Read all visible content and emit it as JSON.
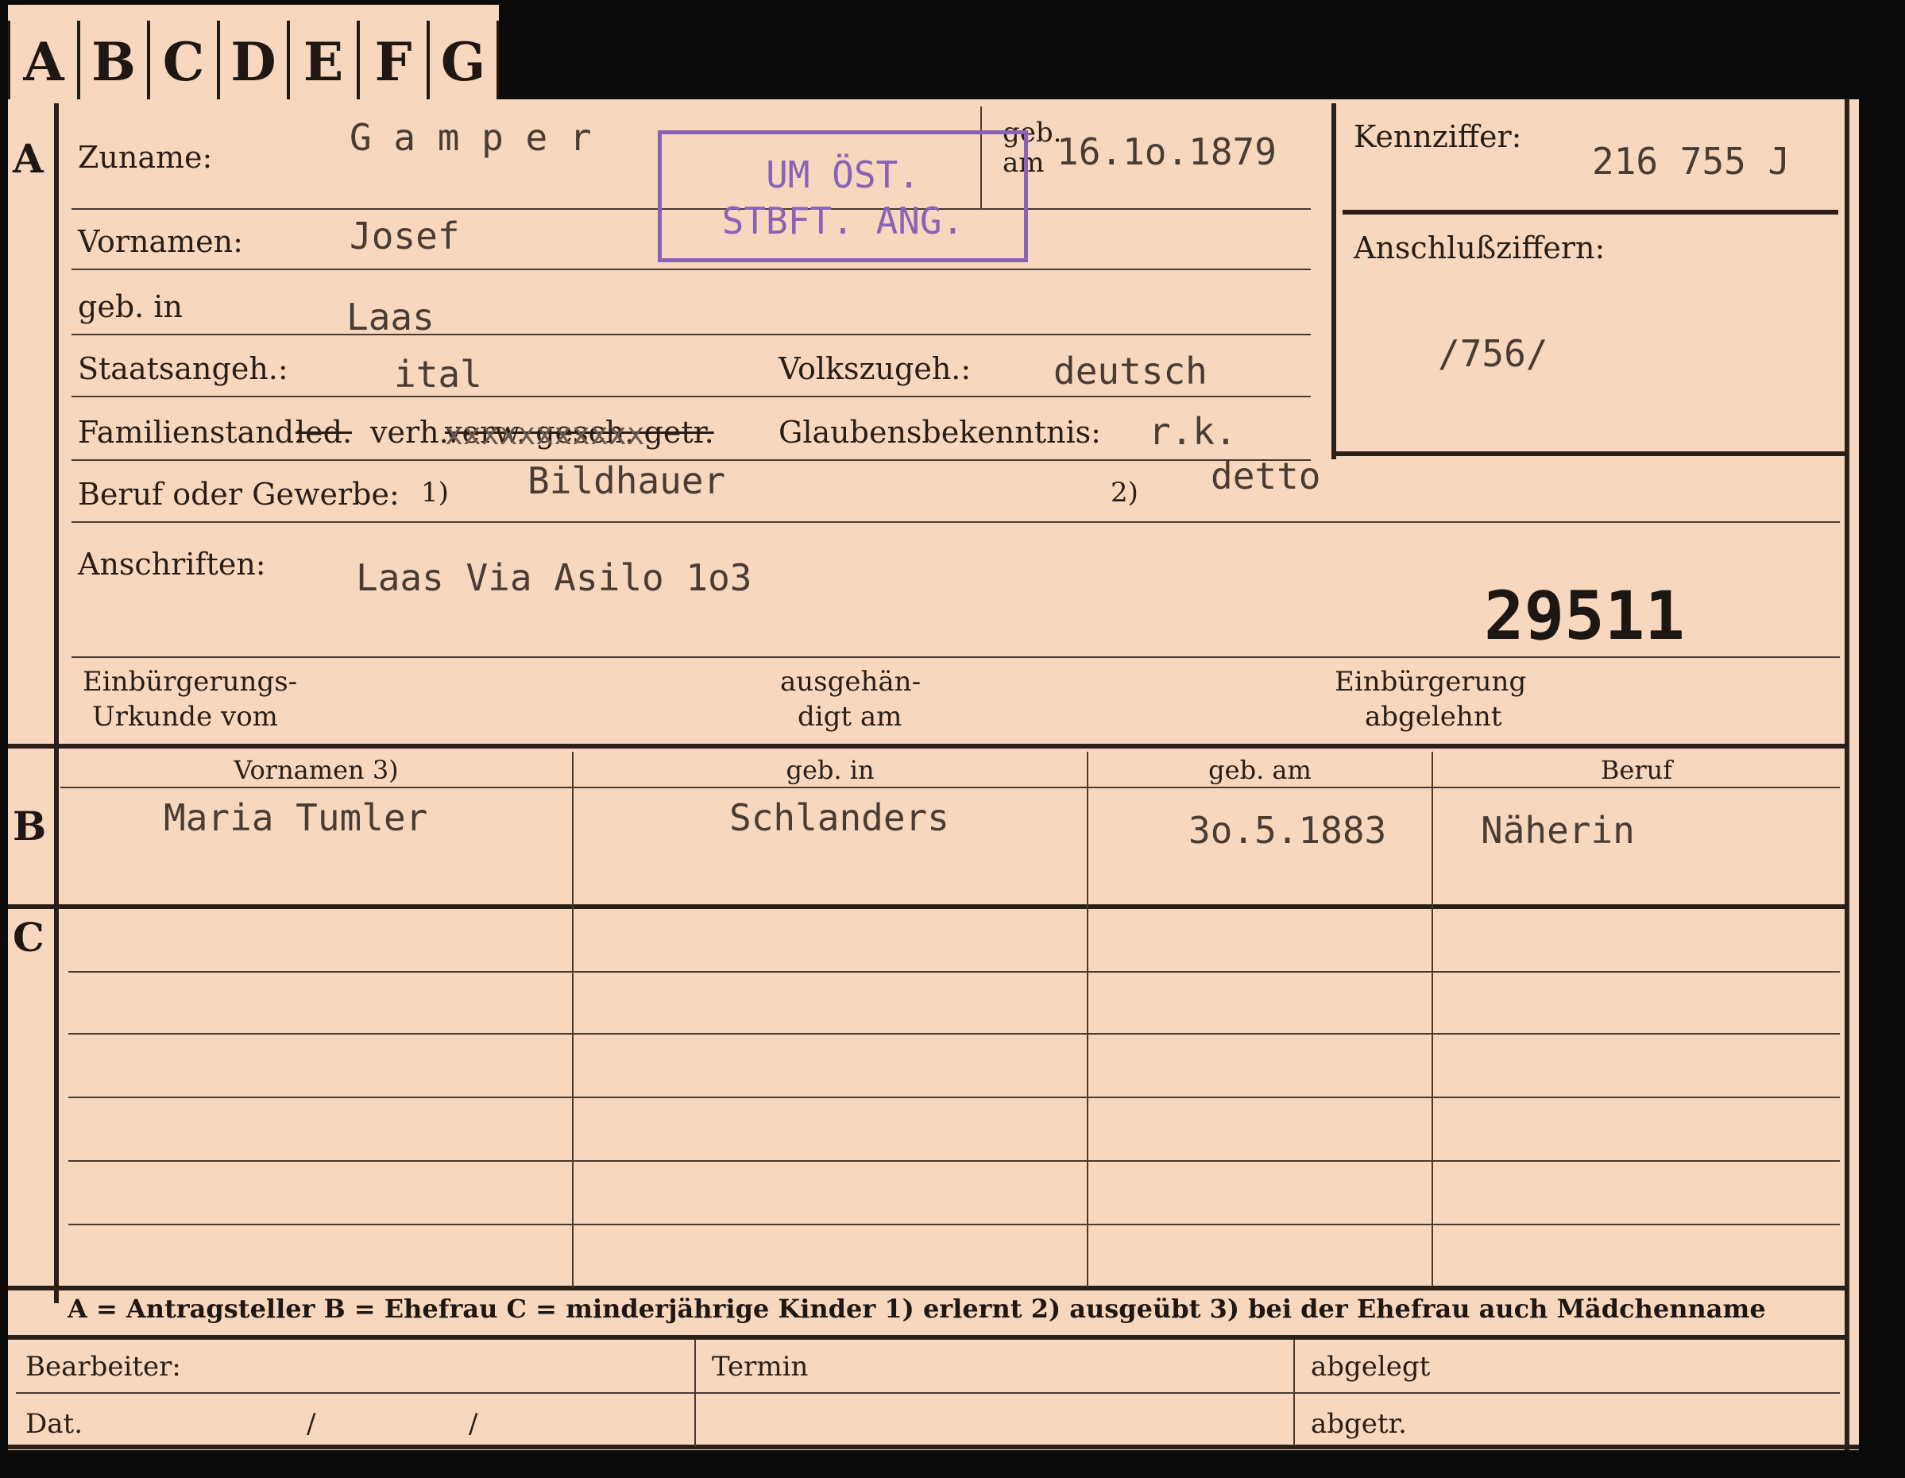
{
  "tabs": [
    "A",
    "B",
    "C",
    "D",
    "E",
    "F",
    "G"
  ],
  "sections": {
    "a": "A",
    "b": "B",
    "c": "C"
  },
  "person": {
    "zuname_label": "Zuname:",
    "zuname": "G a m p e r",
    "geb_am_label": "geb. am",
    "geb_am": "16.1o.1879",
    "vornamen_label": "Vornamen:",
    "vornamen": "Josef",
    "geb_in_label": "geb. in",
    "geb_in": "Laas",
    "staatsangeh_label": "Staatsangeh.:",
    "staatsangeh": "ital",
    "volkszugeh_label": "Volkszugeh.:",
    "volkszugeh": "deutsch",
    "familienstand_label": "Familienstand:",
    "familienstand_struck_1": "led.",
    "familienstand_value": "verh.",
    "familienstand_struck_2": "verw. gesch. getr.",
    "familienstand_overtype": "xxxxxxxxxxx",
    "glaubens_label": "Glaubensbekenntnis:",
    "glaubens": "r.k.",
    "beruf_label": "Beruf oder Gewerbe:",
    "beruf_note1": "1)",
    "beruf": "Bildhauer",
    "beruf_note2": "2)",
    "beruf2": "detto",
    "anschriften_label": "Anschriften:",
    "anschrift": "Laas  Via Asilo  1o3",
    "einb_urkunde_label_1": "Einbürgerungs-",
    "einb_urkunde_label_2": "Urkunde vom",
    "ausgehaendigt_label_1": "ausgehän-",
    "ausgehaendigt_label_2": "digt am",
    "einb_abgelehnt_label_1": "Einbürgerung",
    "einb_abgelehnt_label_2": "abgelehnt"
  },
  "stamp": {
    "line1": "UM ÖST.",
    "line2": "STBFT. ANG."
  },
  "kennziffer": {
    "label": "Kennziffer:",
    "value": "216 755 J"
  },
  "anschlussziffern": {
    "label": "Anschlußziffern:",
    "value": "/756/"
  },
  "file_number": "29511",
  "table": {
    "headers": [
      "Vornamen 3)",
      "geb. in",
      "geb. am",
      "Beruf"
    ],
    "rows": [
      {
        "vornamen": "Maria  Tumler",
        "geb_in": "Schlanders",
        "geb_am": "3o.5.1883",
        "beruf": "Näherin"
      }
    ]
  },
  "legend": "A = Antragsteller   B = Ehefrau   C = minderjährige Kinder   1) erlernt   2) ausgeübt   3) bei der Ehefrau auch Mädchenname",
  "footer": {
    "bearbeiter_label": "Bearbeiter:",
    "dat_label": "Dat.",
    "slash1": "/",
    "slash2": "/",
    "termin_label": "Termin",
    "abgelegt_label": "abgelegt",
    "abgetr_label": "abgetr."
  },
  "colors": {
    "paper": "#f7d7bd",
    "ink": "#2a1d15",
    "typewriter": "#4a3c33",
    "stamp": "#8a62b8"
  }
}
